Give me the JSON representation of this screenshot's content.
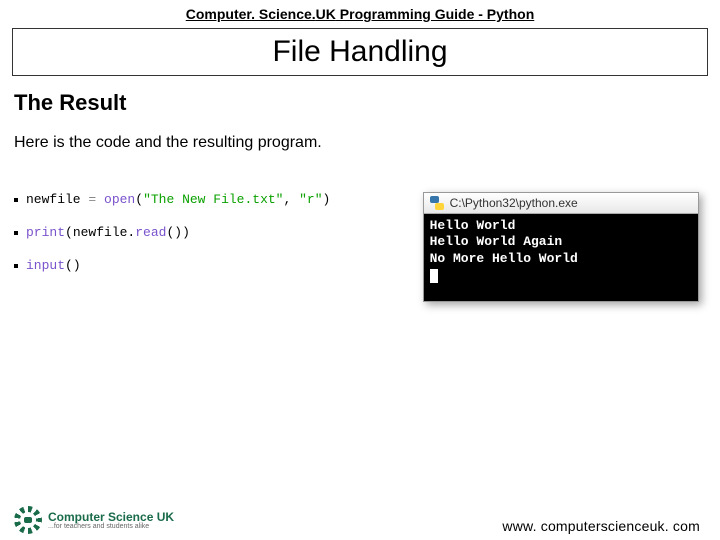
{
  "header": {
    "brand_prefix": "Computer. Science.",
    "brand_suffix": "UK",
    "guide_suffix": " Programming Guide - Python"
  },
  "title": "File Handling",
  "section_heading": "The Result",
  "body_text": "Here is the code and the resulting program.",
  "code_lines": [
    {
      "var": "newfile ",
      "op": "= ",
      "fn": "open",
      "paren_l": "(",
      "str": "\"The New File.txt\"",
      "comma": ", ",
      "str2": "\"r\"",
      "paren_r": ")"
    },
    {
      "fn": "print",
      "paren_l": "(",
      "plain": "newfile.",
      "fn2": "read",
      "paren_l2": "(",
      "paren_r2": ")",
      "paren_r": ")"
    },
    {
      "fn": "input",
      "paren_l": "(",
      "paren_r": ")"
    }
  ],
  "console": {
    "title_path": "C:\\Python32\\python.exe",
    "lines": [
      "Hello World",
      "Hello World Again",
      "No More Hello World"
    ]
  },
  "footer": {
    "brand_name": "Computer Science UK",
    "brand_tagline": "...for teachers and students alike",
    "url": "www. computerscienceuk. com"
  }
}
